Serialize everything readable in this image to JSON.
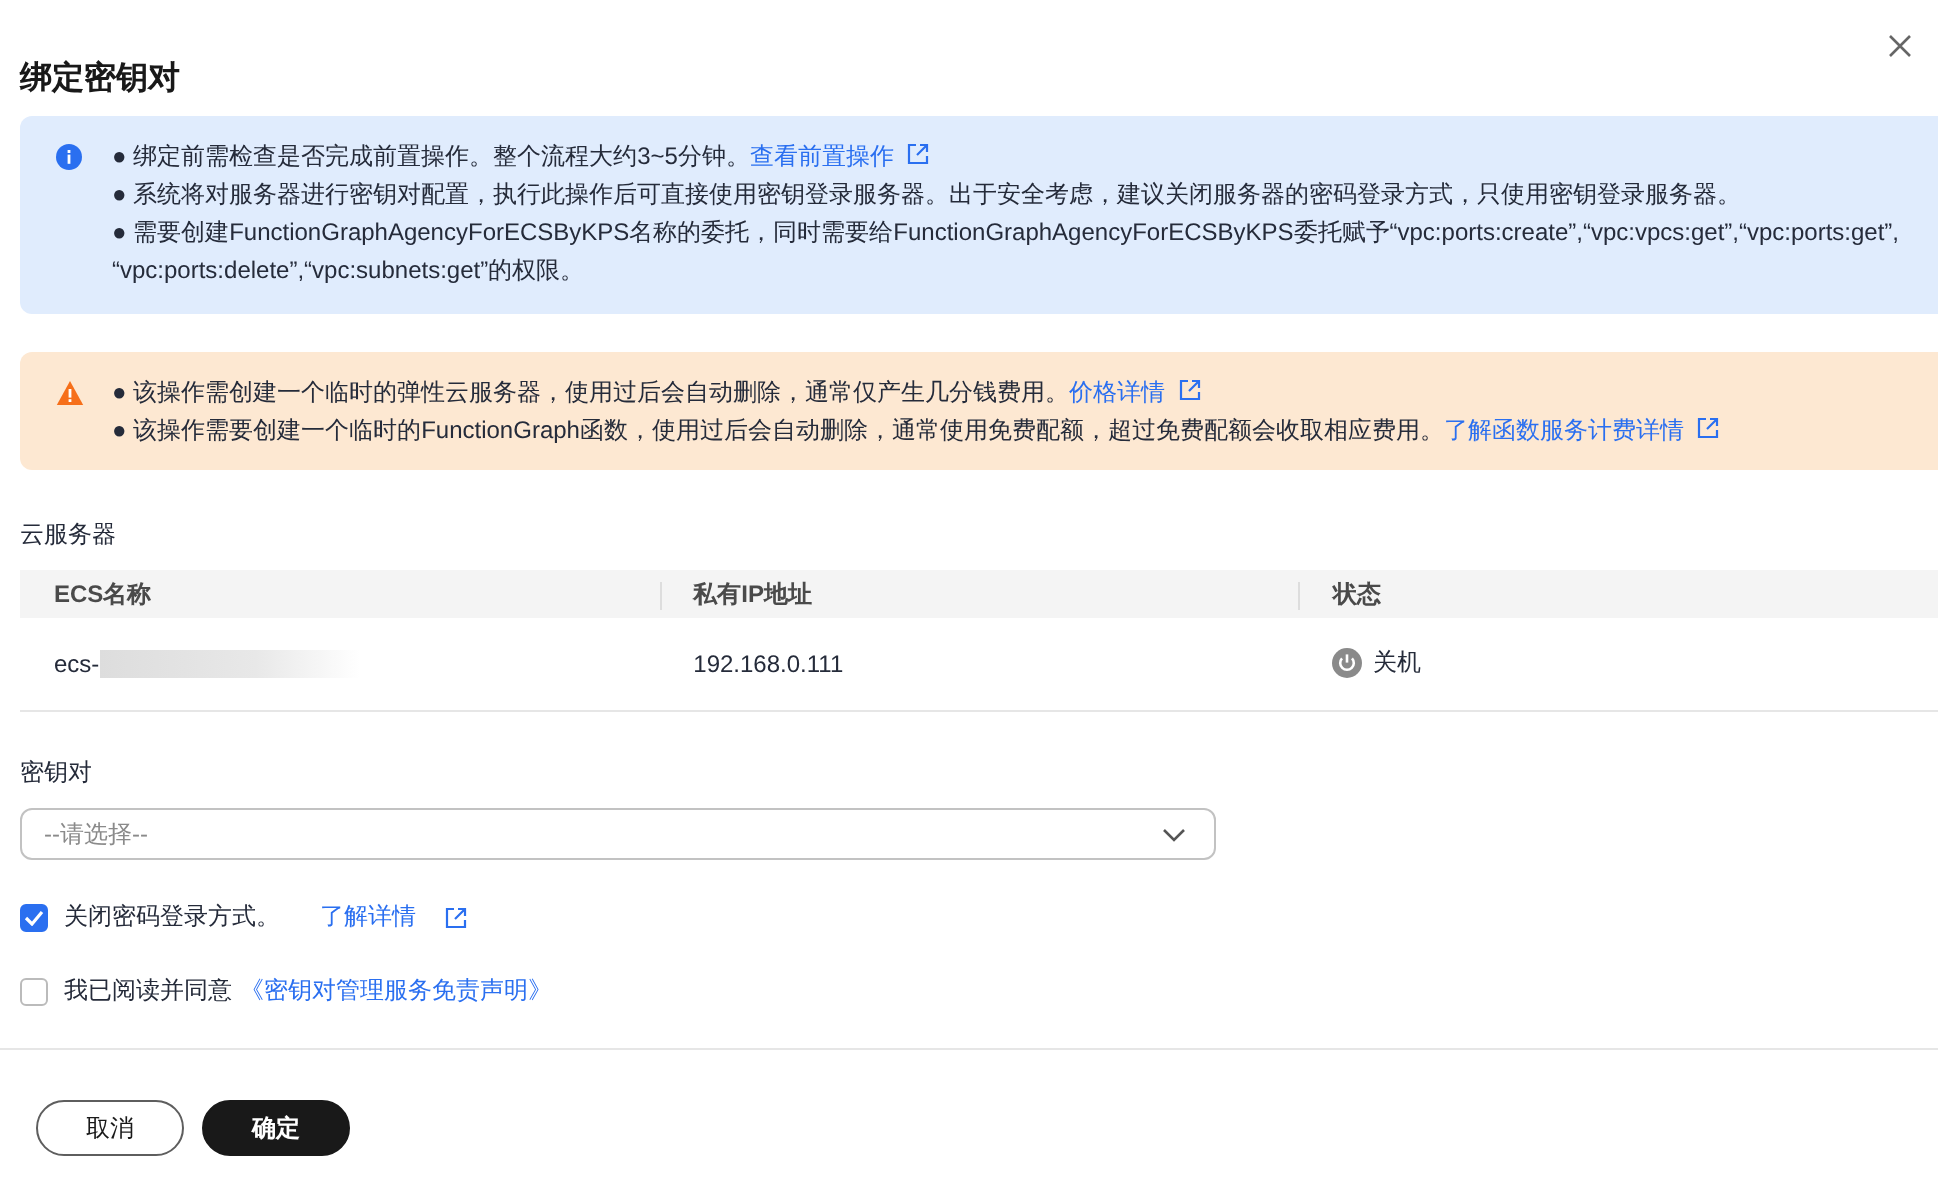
{
  "dialog": {
    "title": "绑定密钥对"
  },
  "info_notice": {
    "items": [
      {
        "text": "● 绑定前需检查是否完成前置操作。整个流程大约3~5分钟。",
        "link": "查看前置操作"
      },
      {
        "text": "● 系统将对服务器进行密钥对配置，执行此操作后可直接使用密钥登录服务器。出于安全考虑，建议关闭服务器的密码登录方式，只使用密钥登录服务器。"
      },
      {
        "text": "● 需要创建FunctionGraphAgencyForECSByKPS名称的委托，同时需要给FunctionGraphAgencyForECSByKPS委托赋予“vpc:ports:create”,“vpc:vpcs:get”,“vpc:ports:get”, “vpc:ports:delete”,“vpc:subnets:get”的权限。"
      }
    ]
  },
  "warning_notice": {
    "items": [
      {
        "text": "● 该操作需创建一个临时的弹性云服务器，使用过后会自动删除，通常仅产生几分钱费用。",
        "link": "价格详情"
      },
      {
        "text": "● 该操作需要创建一个临时的FunctionGraph函数，使用过后会自动删除，通常使用免费配额，超过免费配额会收取相应费用。",
        "link": "了解函数服务计费详情"
      }
    ]
  },
  "servers": {
    "label": "云服务器",
    "columns": [
      "ECS名称",
      "私有IP地址",
      "状态"
    ],
    "rows": [
      {
        "name": "ecs-",
        "ip": "192.168.0.111",
        "status": "关机"
      }
    ]
  },
  "keypair": {
    "label": "密钥对",
    "placeholder": "--请选择--"
  },
  "options": [
    {
      "label": "关闭密码登录方式。",
      "link": "了解详情",
      "external": true,
      "checked": true
    },
    {
      "label": "我已阅读并同意",
      "link": "《密钥对管理服务免责声明》",
      "external": false,
      "checked": false
    }
  ],
  "buttons": [
    {
      "label": "取消",
      "kind": "secondary"
    },
    {
      "label": "确定",
      "kind": "primary"
    }
  ]
}
